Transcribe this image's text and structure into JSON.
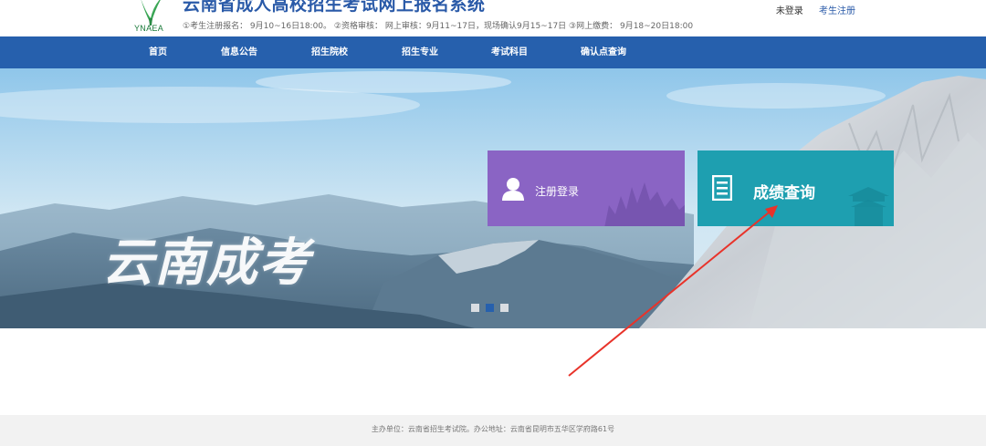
{
  "header": {
    "logo_text": "YNAEA",
    "title": "云南省成人高校招生考试网上报名系统",
    "notice": "①考生注册报名： 9月10~16日18:00。 ②资格审核： 网上审核：9月11~17日，现场确认9月15~17日 ③网上缴费： 9月18~20日18:00",
    "login_status": "未登录",
    "register_link": "考生注册"
  },
  "nav": {
    "items": [
      {
        "label": "首页"
      },
      {
        "label": "信息公告"
      },
      {
        "label": "招生院校"
      },
      {
        "label": "招生专业"
      },
      {
        "label": "考试科目"
      },
      {
        "label": "确认点查询"
      }
    ]
  },
  "banner": {
    "calligraphy": "云南成考",
    "cards": {
      "login": {
        "label": "注册登录",
        "icon": "user-icon",
        "color": "#8a64c4"
      },
      "score": {
        "label": "成绩查询",
        "icon": "document-icon",
        "color": "#1e9fb0"
      }
    },
    "slides": {
      "count": 3,
      "active": 2
    }
  },
  "annotation": {
    "type": "arrow",
    "color": "#e8332a",
    "points_to": "score-query-card"
  },
  "footer": {
    "text": "主办单位：云南省招生考试院。办公地址：云南省昆明市五华区学府路61号"
  },
  "colors": {
    "nav": "#2660ad",
    "title": "#2a5aa8",
    "footer_bg": "#f2f2f2"
  }
}
